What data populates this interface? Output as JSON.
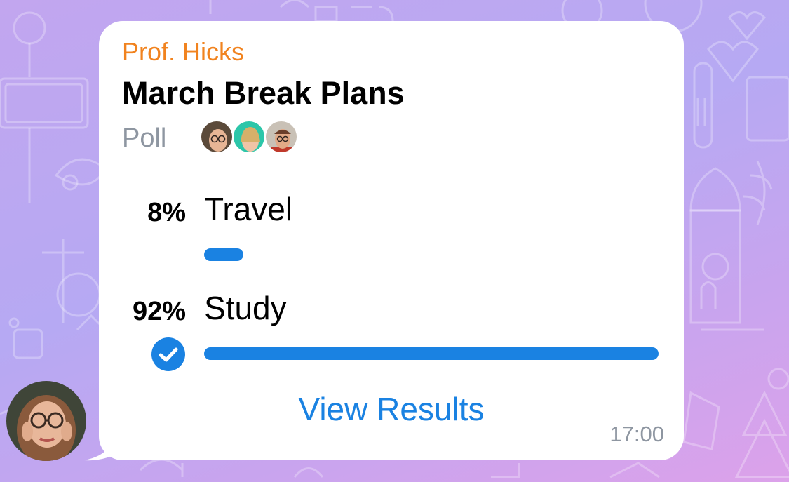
{
  "message": {
    "sender": "Prof. Hicks",
    "time": "17:00",
    "poll": {
      "question": "March Break Plans",
      "type_label": "Poll",
      "options": [
        {
          "percent_label": "8%",
          "label": "Travel",
          "percent": 8,
          "chosen": false
        },
        {
          "percent_label": "92%",
          "label": "Study",
          "percent": 92,
          "chosen": true
        }
      ],
      "action_label": "View Results"
    }
  },
  "colors": {
    "sender": "#f1831f",
    "accent": "#1a82e2",
    "muted": "#8e96a1",
    "bubble": "#ffffff"
  },
  "icons": {
    "chosen_option": "check-circle-icon"
  }
}
